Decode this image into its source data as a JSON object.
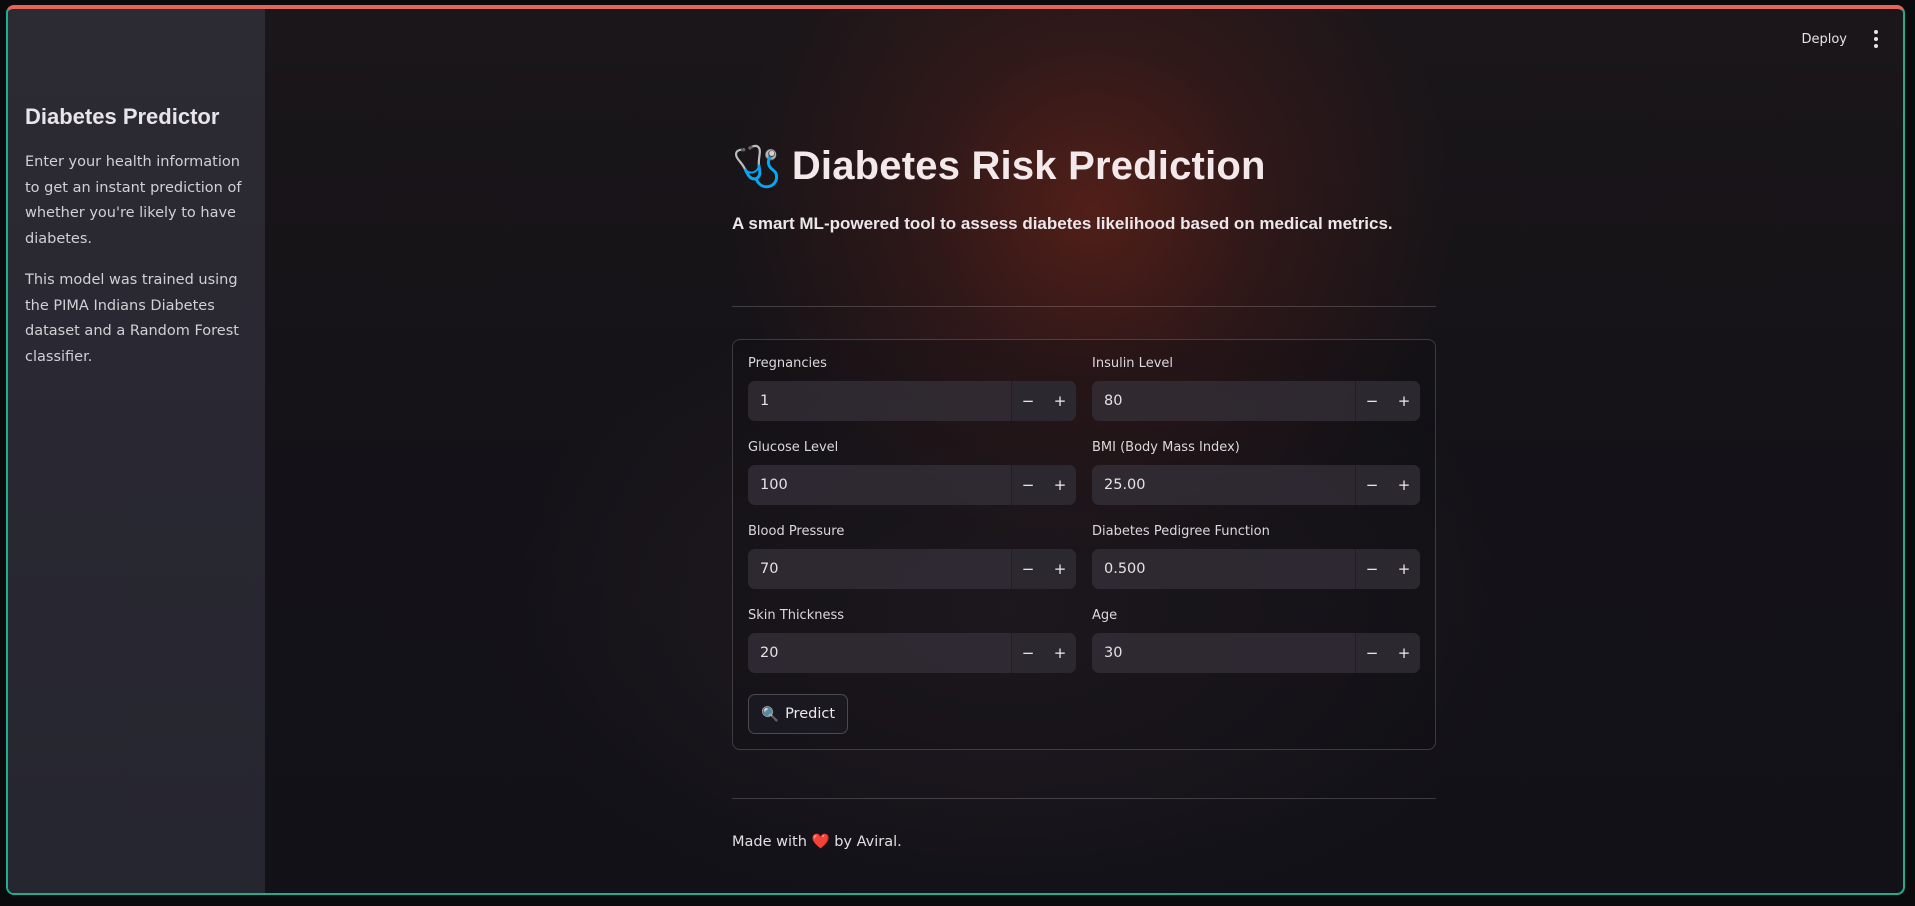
{
  "topbar": {
    "deploy_label": "Deploy",
    "menu_icon": "kebab-menu-icon"
  },
  "sidebar": {
    "title": "Diabetes Predictor",
    "paragraphs": [
      "Enter your health information to get an instant prediction of whether you're likely to have diabetes.",
      "This model was trained using the PIMA Indians Diabetes dataset and a Random Forest classifier."
    ]
  },
  "header": {
    "icon": "🩺",
    "title": "Diabetes Risk Prediction",
    "subtitle": "A smart ML-powered tool to assess diabetes likelihood based on medical metrics."
  },
  "form": {
    "fields": [
      {
        "label": "Pregnancies",
        "value": "1"
      },
      {
        "label": "Insulin Level",
        "value": "80"
      },
      {
        "label": "Glucose Level",
        "value": "100"
      },
      {
        "label": "BMI (Body Mass Index)",
        "value": "25.00"
      },
      {
        "label": "Blood Pressure",
        "value": "70"
      },
      {
        "label": "Diabetes Pedigree Function",
        "value": "0.500"
      },
      {
        "label": "Skin Thickness",
        "value": "20"
      },
      {
        "label": "Age",
        "value": "30"
      }
    ],
    "minus_symbol": "−",
    "plus_symbol": "+",
    "predict_icon": "🔍",
    "predict_label": "Predict"
  },
  "footer": {
    "prefix": "Made with",
    "heart": "❤️",
    "suffix": "by Aviral."
  },
  "colors": {
    "accent_top": "#e4655a",
    "accent_border": "#1fae8e",
    "sidebar_bg": "#2c2a33"
  }
}
